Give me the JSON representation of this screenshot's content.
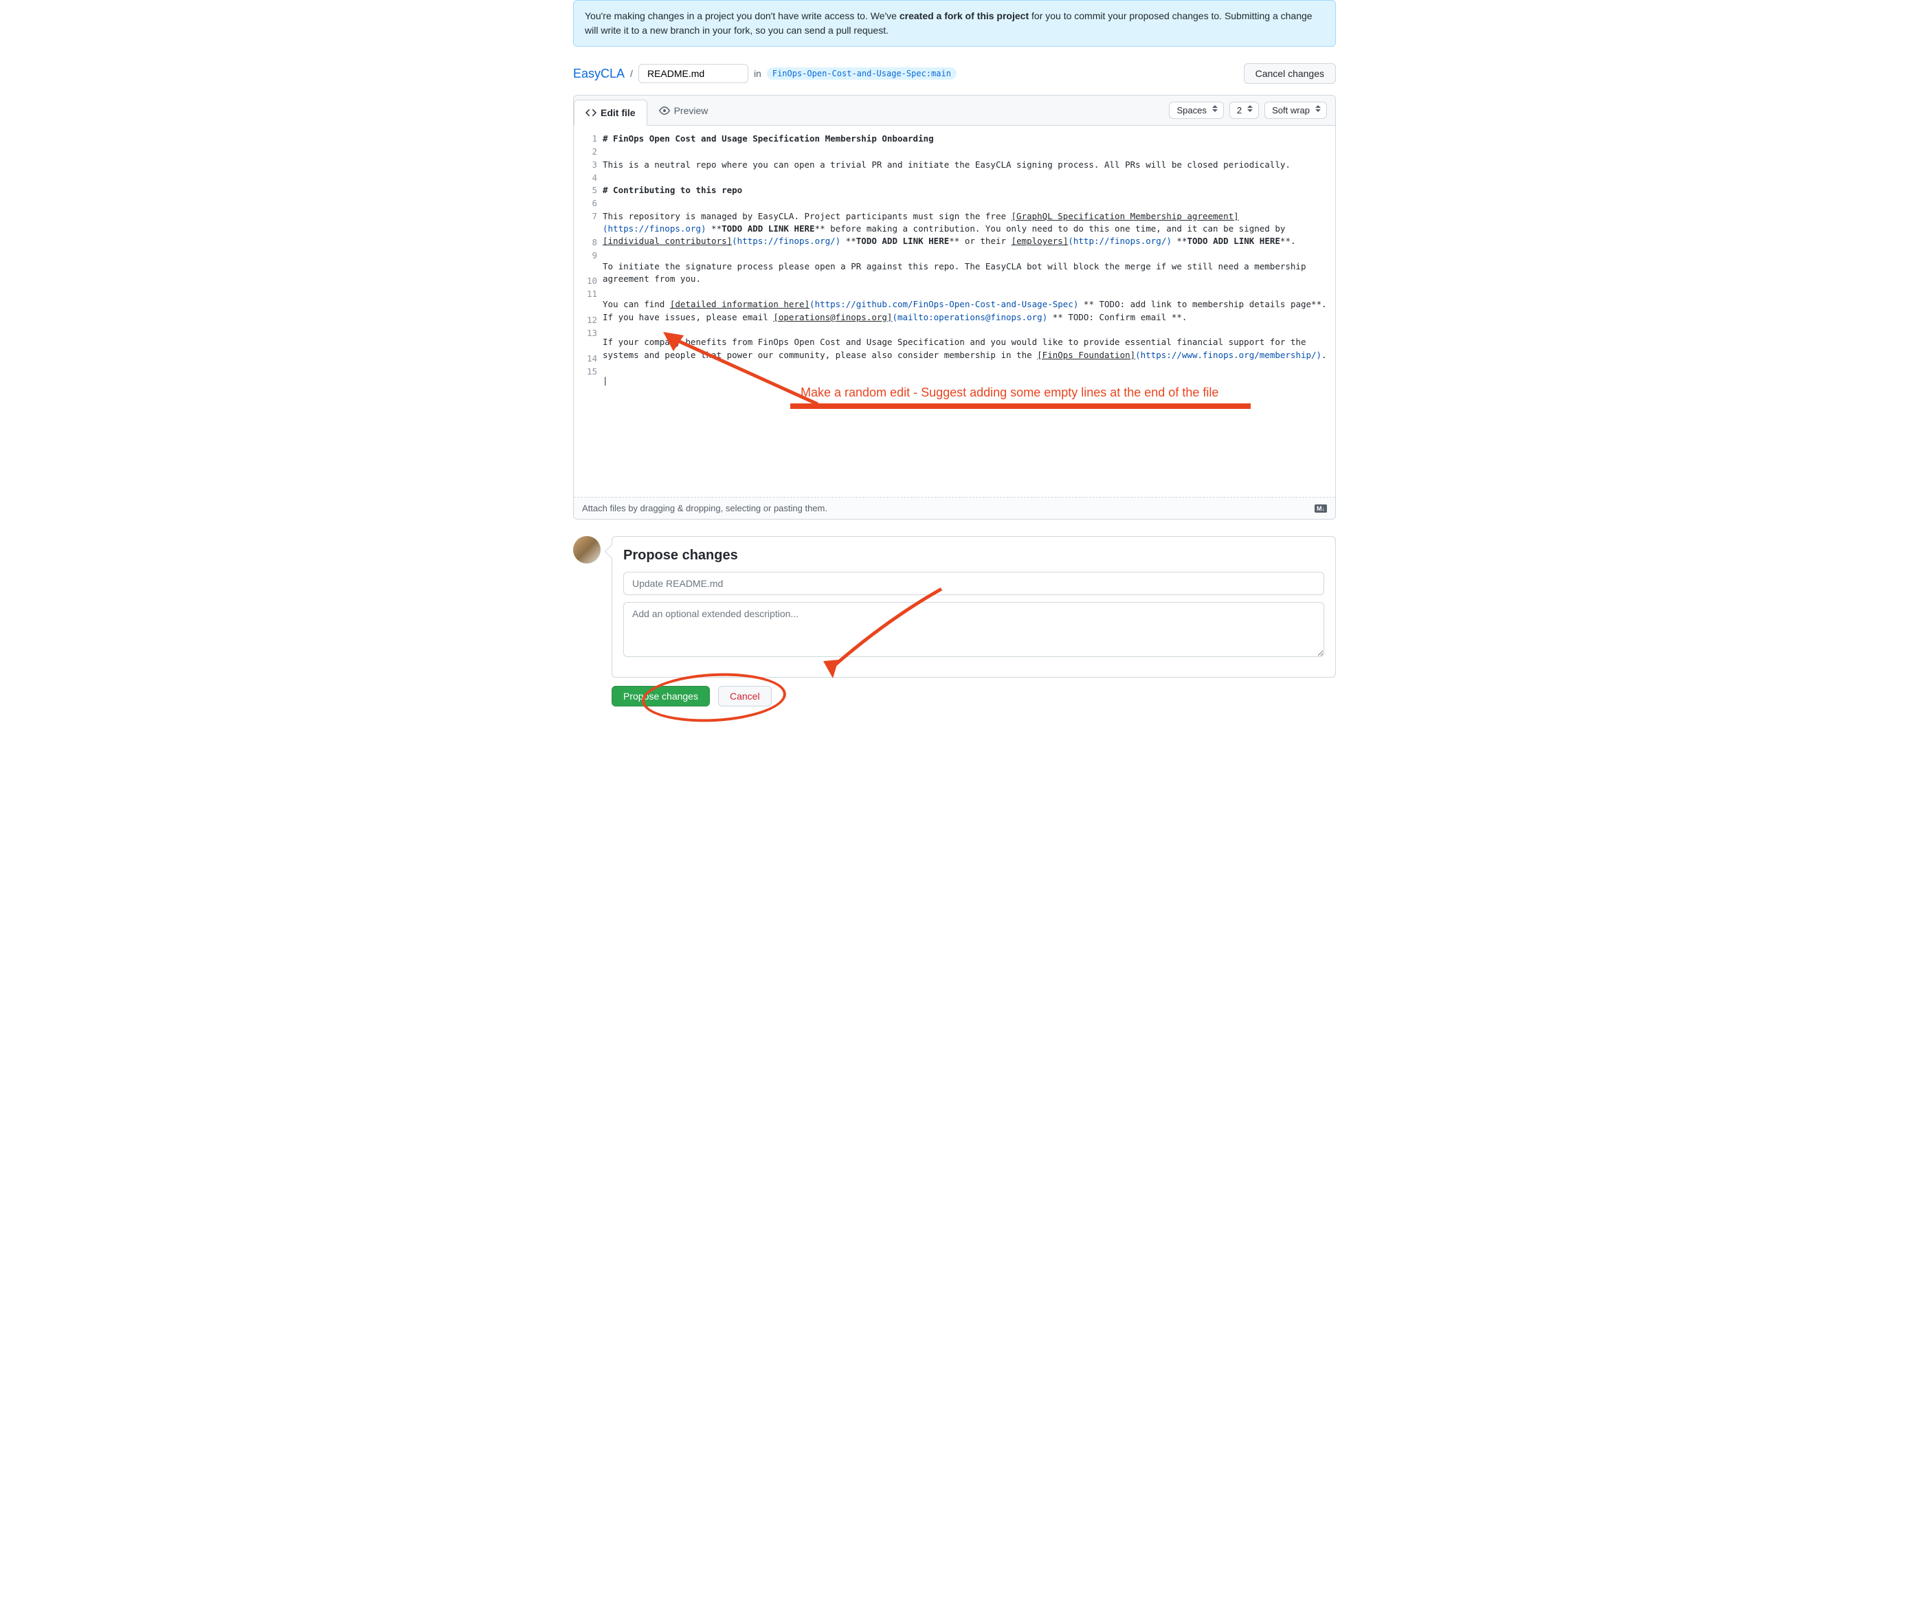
{
  "notice": {
    "prefix": "You're making changes in a project you don't have write access to. We've ",
    "bold": "created a fork of this project",
    "suffix": " for you to commit your proposed changes to. Submitting a change will write it to a new branch in your fork, so you can send a pull request."
  },
  "path": {
    "repo": "EasyCLA",
    "file": "README.md",
    "in": "in",
    "branch": "FinOps-Open-Cost-and-Usage-Spec:main"
  },
  "buttons": {
    "cancel_changes": "Cancel changes",
    "propose": "Propose changes",
    "cancel": "Cancel"
  },
  "tabs": {
    "edit": "Edit file",
    "preview": "Preview"
  },
  "selectors": {
    "indent_mode": "Spaces",
    "indent_size": "2",
    "wrap": "Soft wrap"
  },
  "line_numbers": [
    "1",
    "2",
    "3",
    "4",
    "5",
    "6",
    "7",
    "8",
    "9",
    "10",
    "11",
    "12",
    "13",
    "14",
    "15"
  ],
  "code": {
    "l1": "# FinOps Open Cost and Usage Specification Membership Onboarding",
    "l3": "This is a neutral repo where you can open a trivial PR and initiate the EasyCLA signing process. All PRs will be closed periodically.",
    "l5": "# Contributing to this repo",
    "l7_a": "This repository is managed by EasyCLA. Project participants must sign the free ",
    "l7_link1_t": "[GraphQL Specification Membership agreement]",
    "l7_link1_u": "(https://finops.org)",
    "l7_b": " **",
    "l7_bold1": "TODO ADD LINK HERE",
    "l7_c": "** before making a contribution. You only need to do this one time, and it can be signed by ",
    "l7_link2_t": "[individual contributors]",
    "l7_link2_u": "(https://finops.org/)",
    "l7_d": " **",
    "l7_bold2": "TODO ADD LINK HERE",
    "l7_e": "** or their ",
    "l7_link3_t": "[employers]",
    "l7_link3_u": "(http://finops.org/)",
    "l7_f": " **",
    "l7_bold3": "TODO ADD LINK HERE",
    "l7_g": "**.",
    "l9": "To initiate the signature process please open a PR against this repo. The EasyCLA bot will block the merge if we still need a membership agreement from you.",
    "l11_a": "You can find ",
    "l11_link1_t": "[detailed information here]",
    "l11_link1_u": "(https://github.com/FinOps-Open-Cost-and-Usage-Spec)",
    "l11_b": " ** TODO: add link to membership details page**. If you have issues, please email ",
    "l11_link2_t": "[operations@finops.org]",
    "l11_link2_u": "(mailto:operations@finops.org)",
    "l11_c": " ** TODO: Confirm email **.",
    "l13_a": "If your company benefits from FinOps Open Cost and Usage Specification and you would like to provide essential financial support for the systems and people that power our community, please also consider membership in the ",
    "l13_link_t": "[FinOps Foundation]",
    "l13_link_u": "(https://www.finops.org/membership/)",
    "l13_b": "."
  },
  "attach_hint": "Attach files by dragging & dropping, selecting or pasting them.",
  "md_badge": "M↓",
  "propose": {
    "heading": "Propose changes",
    "summary_placeholder": "Update README.md",
    "description_placeholder": "Add an optional extended description..."
  },
  "annotations": {
    "text1": "Make a random edit - Suggest adding some empty lines at the end of the file"
  }
}
